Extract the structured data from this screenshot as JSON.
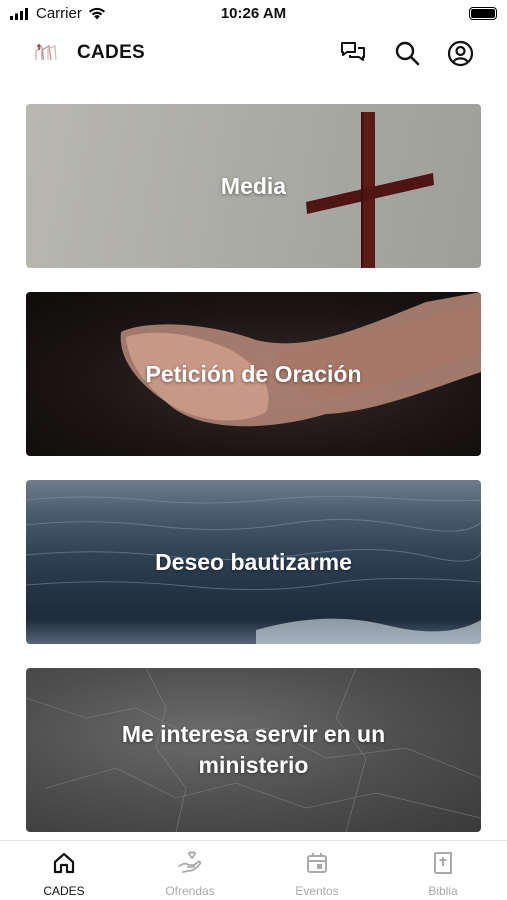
{
  "status_bar": {
    "carrier": "Carrier",
    "time": "10:26 AM",
    "battery_level": 1.0
  },
  "header": {
    "title": "CADES",
    "icons": [
      "chat-icon",
      "search-icon",
      "account-icon"
    ]
  },
  "cards": [
    {
      "label": "Media"
    },
    {
      "label": "Petición de Oración"
    },
    {
      "label": "Deseo bautizarme"
    },
    {
      "label": "Me interesa servir en un ministerio"
    }
  ],
  "bottom_nav": {
    "items": [
      {
        "label": "CADES",
        "icon": "home-icon",
        "active": true
      },
      {
        "label": "Ofrendas",
        "icon": "offering-hand-icon",
        "active": false
      },
      {
        "label": "Eventos",
        "icon": "calendar-icon",
        "active": false
      },
      {
        "label": "Biblia",
        "icon": "bible-icon",
        "active": false
      }
    ]
  },
  "colors": {
    "accent": "#111111",
    "inactive": "#a9a9a9",
    "card_text": "#ffffff",
    "cross": "#5a1a16"
  }
}
